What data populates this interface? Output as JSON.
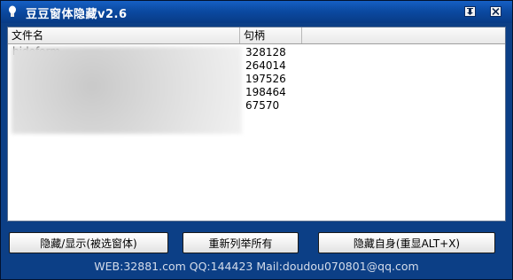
{
  "window": {
    "title": "豆豆窗体隐藏v2.6",
    "icons": {
      "app": "lightbulb-icon",
      "pin": "pin-icon",
      "close": "close-icon"
    }
  },
  "list": {
    "columns": [
      {
        "label": "文件名"
      },
      {
        "label": "句柄"
      },
      {
        "label": ""
      }
    ],
    "rows": [
      {
        "name": "hideform",
        "handle": "328128"
      },
      {
        "name": "",
        "handle": "264014"
      },
      {
        "name": "",
        "handle": "197526"
      },
      {
        "name": "",
        "handle": "198464"
      },
      {
        "name": "",
        "handle": "67570"
      }
    ]
  },
  "buttons": {
    "hide_show": "隐藏/显示(被选窗体)",
    "refresh": "重新列举所有",
    "hide_self": "隐藏自身(重显ALT+X)"
  },
  "status": {
    "text": "WEB:32881.com QQ:144423 Mail:doudou070801@qq.com"
  },
  "colors": {
    "frame": "#0c3f86",
    "titlebar": "#0b4aa2",
    "list_bg": "#ffffff"
  }
}
